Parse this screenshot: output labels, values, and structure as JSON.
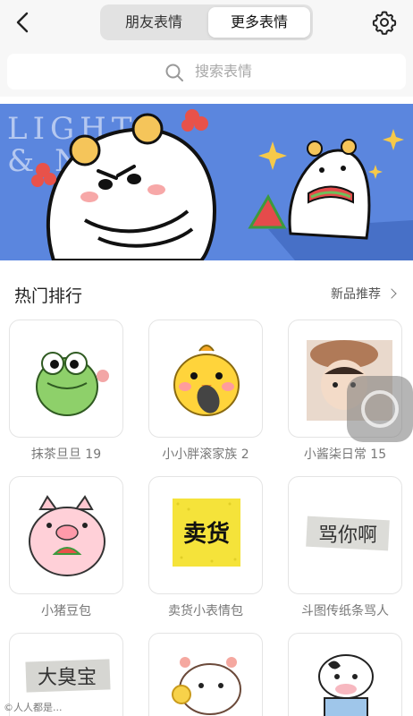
{
  "header": {
    "tabs": [
      {
        "label": "朋友表情",
        "active": false
      },
      {
        "label": "更多表情",
        "active": true
      }
    ]
  },
  "search": {
    "placeholder": "搜索表情"
  },
  "banner": {
    "text_line1": "LIGHT",
    "text_line2": "& N"
  },
  "section": {
    "title": "热门排行",
    "more_label": "新品推荐"
  },
  "stickers": [
    {
      "name": "抹茶旦旦 19",
      "icon": "green-crocodile-sticker"
    },
    {
      "name": "小小胖滚家族 2",
      "icon": "yellow-chick-sticker"
    },
    {
      "name": "小酱柒日常 15",
      "icon": "child-photo-sticker"
    },
    {
      "name": "小猪豆包",
      "icon": "pink-pig-sticker"
    },
    {
      "name": "卖货小表情包",
      "icon": "selling-text-sticker",
      "text": "卖货"
    },
    {
      "name": "斗图传纸条骂人",
      "icon": "handwritten-note-sticker",
      "text": "骂你啊"
    },
    {
      "name": "",
      "icon": "handwritten-note-sticker-2",
      "text": "大臭宝"
    },
    {
      "name": "",
      "icon": "bear-lollipop-sticker"
    },
    {
      "name": "",
      "icon": "cow-sticker"
    }
  ],
  "watermark": "©人人都是..."
}
